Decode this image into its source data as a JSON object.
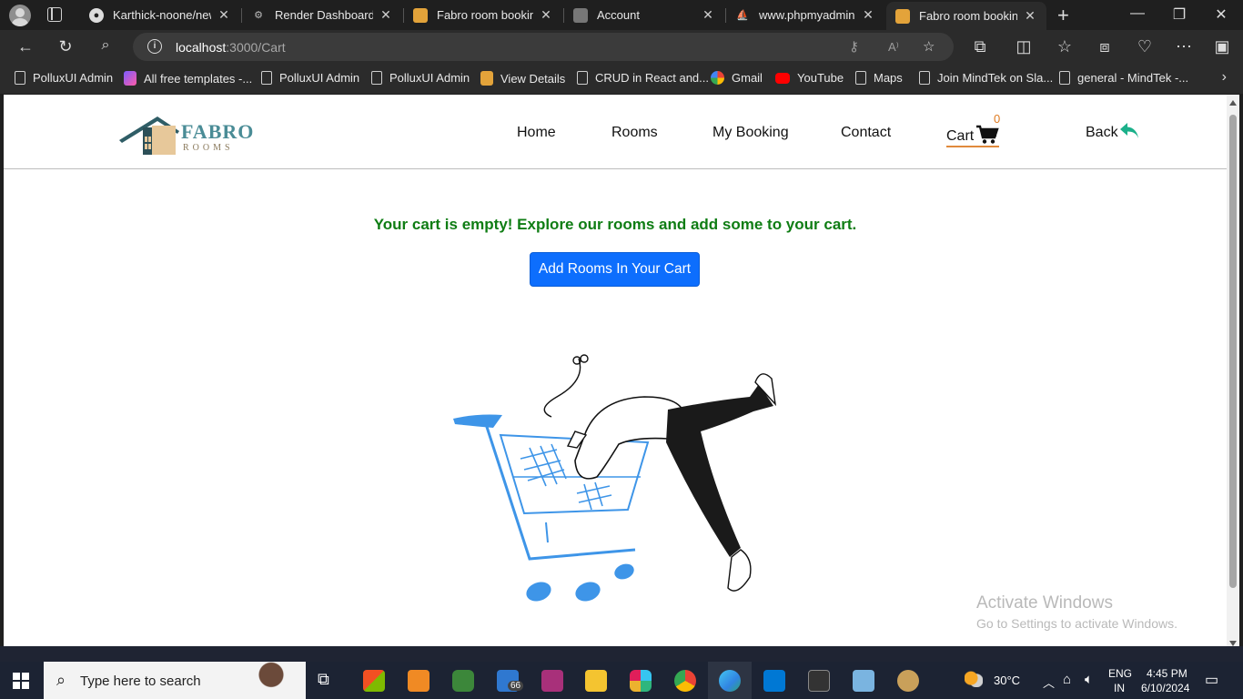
{
  "browser": {
    "tabs": [
      {
        "title": "Karthick-noone/new",
        "icon": "github-icon"
      },
      {
        "title": "Render Dashboard",
        "icon": "render-icon"
      },
      {
        "title": "Fabro room booking",
        "icon": "fabro-icon"
      },
      {
        "title": "Account",
        "icon": "account-icon"
      },
      {
        "title": "www.phpmyadmin.co",
        "icon": "phpmyadmin-icon"
      },
      {
        "title": "Fabro room booking",
        "icon": "fabro-icon"
      }
    ],
    "address": {
      "host": "localhost",
      "path": ":3000/Cart"
    },
    "bookmarks": [
      {
        "label": "PolluxUI Admin"
      },
      {
        "label": "All free templates -..."
      },
      {
        "label": "PolluxUI Admin"
      },
      {
        "label": "PolluxUI Admin"
      },
      {
        "label": "View Details"
      },
      {
        "label": "CRUD in React and..."
      },
      {
        "label": "Gmail"
      },
      {
        "label": "YouTube"
      },
      {
        "label": "Maps"
      },
      {
        "label": "Join MindTek on Sla..."
      },
      {
        "label": "general - MindTek -..."
      }
    ]
  },
  "site": {
    "logo": {
      "brand": "FABRO",
      "sub": "ROOMS"
    },
    "nav": {
      "home": "Home",
      "rooms": "Rooms",
      "my_booking": "My Booking",
      "contact": "Contact",
      "cart": "Cart",
      "cart_count": "0",
      "back": "Back"
    },
    "cart": {
      "empty_message": "Your cart is empty! Explore our rooms and add some to your cart.",
      "button_label": "Add Rooms In Your Cart"
    },
    "colors": {
      "success": "#0f7d14",
      "primary": "#0d6efd",
      "cart_accent": "#e07b20",
      "brand": "#4a8c96"
    }
  },
  "watermark": {
    "line1": "Activate Windows",
    "line2": "Go to Settings to activate Windows."
  },
  "taskbar": {
    "search_placeholder": "Type here to search",
    "mail_badge": "66",
    "weather": "30°C",
    "lang_top": "ENG",
    "lang_bottom": "IN",
    "time": "4:45 PM",
    "date": "6/10/2024"
  }
}
